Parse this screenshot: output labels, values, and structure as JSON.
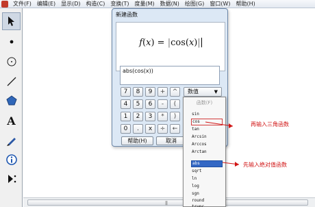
{
  "menubar": {
    "items": [
      "文件(F)",
      "编辑(E)",
      "显示(D)",
      "构造(C)",
      "变换(T)",
      "度量(M)",
      "数据(N)",
      "绘图(G)",
      "窗口(W)",
      "帮助(H)"
    ]
  },
  "toolbox": {
    "tools": [
      "selection-arrow",
      "point",
      "compass",
      "straightedge",
      "polygon",
      "text",
      "marker",
      "information",
      "custom-tools"
    ],
    "text_tool_glyph": "A"
  },
  "dialog": {
    "title": "新建函数",
    "formula": {
      "lhs_f": "f",
      "lhs_open": "(",
      "lhs_x": "x",
      "lhs_close": ")",
      "equals": " = ",
      "abs_open": "|",
      "rhs_text": "cos(",
      "rhs_x": "x",
      "rhs_close": ")",
      "abs_close": "|"
    },
    "expression": "abs(cos(x))",
    "keypad": [
      "7",
      "8",
      "9",
      "+",
      "^",
      "4",
      "5",
      "6",
      "-",
      "(",
      "1",
      "2",
      "3",
      "*",
      ")",
      "0",
      ".",
      "x",
      "÷",
      "←"
    ],
    "value_dropdown_label": "数值",
    "value_dropdown_arrow": "▼",
    "help_button": "帮助(H)",
    "cancel_button": "取消"
  },
  "function_menu": {
    "header": "函数(F)",
    "items": [
      "sin",
      "cos",
      "tan",
      "Arcsin",
      "Arccos",
      "Arctan",
      "abs",
      "sqrt",
      "ln",
      "log",
      "sgn",
      "round",
      "trunc"
    ],
    "boxed_item": "cos",
    "highlighted_item": "abs"
  },
  "annotations": {
    "cos_note": "再输入三角函数",
    "abs_note": "先输入绝对值函数"
  },
  "scrollbar": {
    "grip": "|||"
  },
  "colors": {
    "annotation_red": "#d11515",
    "highlight_blue": "#3468c4",
    "dialog_bg": "#dce8f5"
  }
}
